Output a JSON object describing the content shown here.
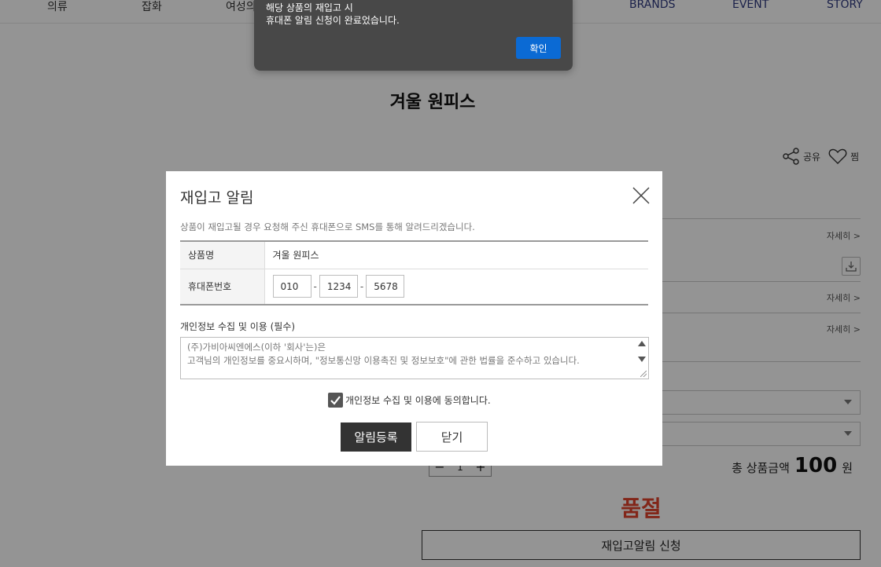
{
  "nav": {
    "items": [
      "의류",
      "잡화",
      "여성의",
      "BRANDS",
      "EVENT",
      "STORY"
    ]
  },
  "product": {
    "title": "겨울 원피스",
    "share_label": "공유",
    "wish_label": "찜",
    "detail_links": [
      "자세히 >",
      "자세히 >",
      "자세히 >"
    ],
    "quantity": "1",
    "total_label": "총 상품금액",
    "total_amount": "100",
    "currency": "원",
    "soldout_text": "품절",
    "restock_button": "재입고알림 신청"
  },
  "modal": {
    "title": "재입고 알림",
    "description": "상품이 재입고될 경우 요청해 주신 휴대폰으로 SMS를 통해 알려드리겠습니다.",
    "product_name_label": "상품명",
    "product_name_value": "겨울 원피스",
    "phone_label": "휴대폰번호",
    "phone": [
      "010",
      "1234",
      "5678"
    ],
    "phone_separator": "-",
    "privacy_label": "개인정보 수집 및 이용 (필수)",
    "privacy_text_line1": "(주)가비아씨엔에스(이하 '회사'는)은",
    "privacy_text_line2": "고객님의 개인정보를 중요시하며, \"정보통신망 이용촉진 및 정보보호\"에 관한 법률을 준수하고 있습니다.",
    "agree_label": "개인정보 수집 및 이용에 동의합니다.",
    "agree_checked": true,
    "register_button": "알림등록",
    "close_button": "닫기"
  },
  "alert": {
    "line1": "해당 상품의 재입고 시",
    "line2": "휴대폰 알림 신청이 완료었습니다.",
    "ok_button": "확인",
    "ok_color": "#0b6ad4"
  }
}
